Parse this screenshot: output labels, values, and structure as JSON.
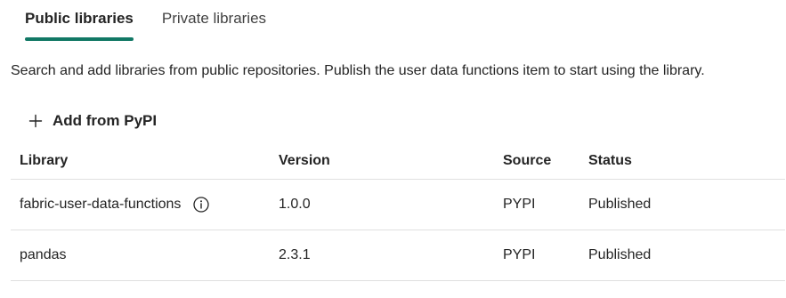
{
  "tabs": [
    {
      "label": "Public libraries",
      "active": true
    },
    {
      "label": "Private libraries",
      "active": false
    }
  ],
  "description": "Search and add libraries from public repositories. Publish the user data functions item to start using the library.",
  "add_button": {
    "label": "Add from PyPI",
    "icon": "plus-icon"
  },
  "table": {
    "columns": [
      "Library",
      "Version",
      "Source",
      "Status"
    ],
    "rows": [
      {
        "library": "fabric-user-data-functions",
        "has_info": true,
        "version": "1.0.0",
        "source": "PYPI",
        "status": "Published"
      },
      {
        "library": "pandas",
        "has_info": false,
        "version": "2.3.1",
        "source": "PYPI",
        "status": "Published"
      }
    ]
  },
  "colors": {
    "accent": "#117865",
    "text": "#242424",
    "divider": "#e0e0e0"
  }
}
